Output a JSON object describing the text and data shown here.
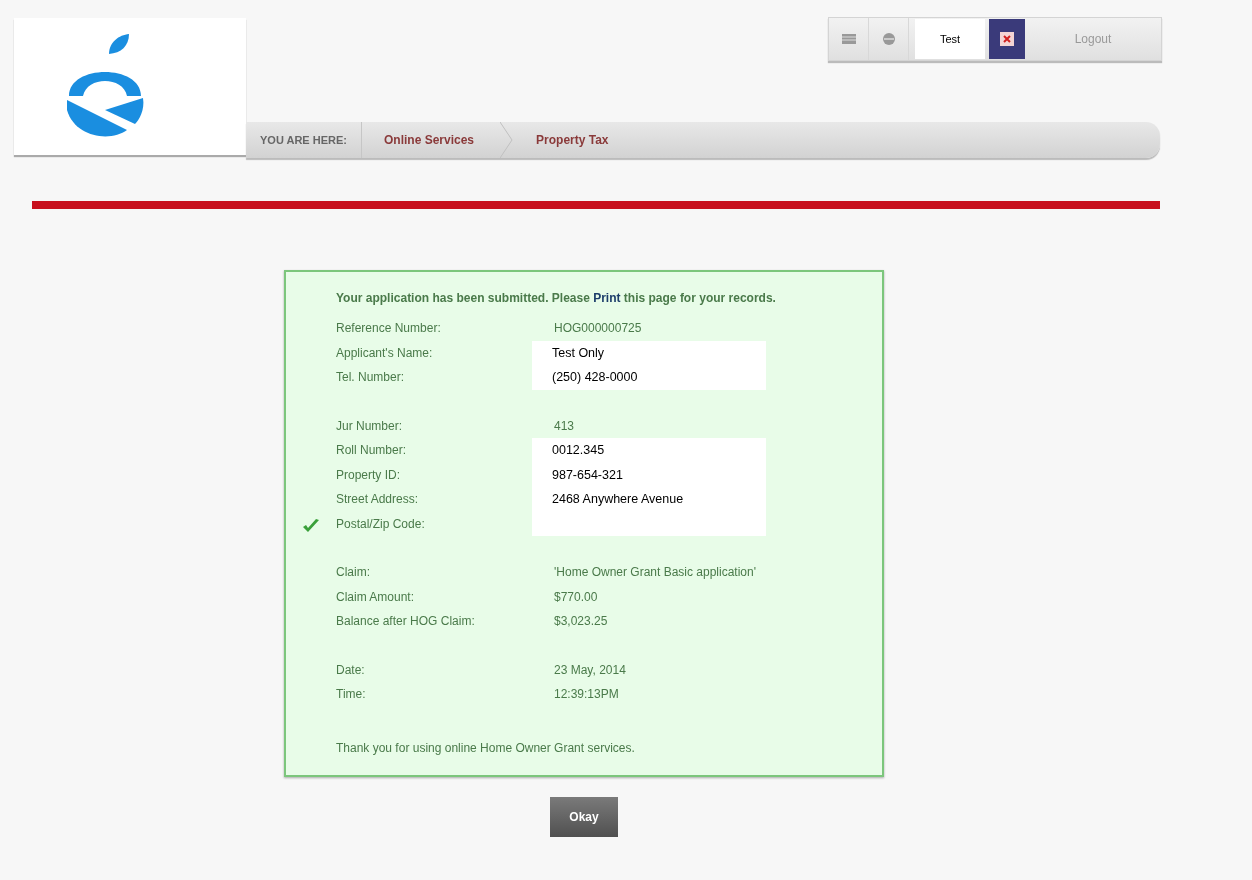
{
  "toolbar": {
    "user": "Test",
    "logout": "Logout"
  },
  "breadcrumb": {
    "label": "YOU ARE HERE:",
    "items": [
      {
        "text": "Online Services"
      },
      {
        "text": "Property Tax"
      }
    ]
  },
  "message": {
    "before": "Your application has been submitted. Please ",
    "link": "Print",
    "after": " this page for your records."
  },
  "groups": [
    {
      "rows": [
        {
          "label": "Reference Number:",
          "value": "HOG000000725",
          "kind": "plain"
        },
        {
          "label": "Applicant's Name:",
          "value": "Test Only",
          "kind": "overlay"
        },
        {
          "label": "Tel. Number:",
          "value": "(250) 428-0000",
          "kind": "overlay"
        }
      ]
    },
    {
      "rows": [
        {
          "label": "Jur Number:",
          "value": "413",
          "kind": "plain"
        },
        {
          "label": "Roll Number:",
          "value": "0012.345",
          "kind": "overlay"
        },
        {
          "label": "Property ID:",
          "value": "987-654-321",
          "kind": "overlay"
        },
        {
          "label": "Street Address:",
          "value": "2468 Anywhere Avenue",
          "kind": "overlay"
        },
        {
          "label": "Postal/Zip Code:",
          "kind": "overlay"
        }
      ]
    },
    {
      "rows": [
        {
          "label": "Claim:",
          "value": "'Home Owner Grant Basic application'",
          "kind": "plain"
        },
        {
          "label": "Claim Amount:",
          "value": "$770.00",
          "kind": "plain"
        },
        {
          "label": "Balance after HOG Claim:",
          "value": "$3,023.25",
          "kind": "plain"
        }
      ]
    },
    {
      "rows": [
        {
          "label": "Date:",
          "value": "23 May, 2014",
          "kind": "plain"
        },
        {
          "label": "Time:",
          "value": "12:39:13PM",
          "kind": "plain"
        }
      ]
    }
  ],
  "thanks": "Thank you for using online Home Owner Grant services.",
  "okay": "Okay"
}
